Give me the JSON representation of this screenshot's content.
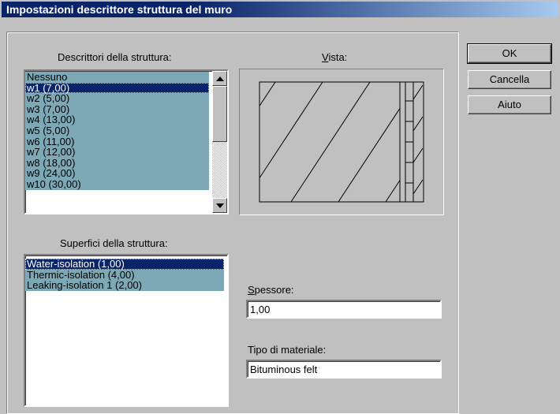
{
  "window": {
    "title": "Impostazioni descrittore struttura del muro"
  },
  "descriptors": {
    "label": "Descrittori della struttura:",
    "items": [
      "Nessuno",
      "w1 (7,00)",
      "w2 (5,00)",
      "w3 (7,00)",
      "w4 (13,00)",
      "w5 (5,00)",
      "w6 (11,00)",
      "w7 (12,00)",
      "w8 (18,00)",
      "w9 (24,00)",
      "w10 (30,00)"
    ],
    "selected": "w1 (7,00)"
  },
  "surfaces": {
    "label": "Superfici della struttura:",
    "items": [
      "Water-isolation (1,00)",
      "Thermic-isolation (4,00)",
      "Leaking-isolation 1 (2,00)"
    ],
    "selected": "Water-isolation (1,00)"
  },
  "preview": {
    "label_key": "V",
    "label_rest": "ista:"
  },
  "thickness": {
    "label_key": "S",
    "label_rest": "pessore:",
    "value": "1,00"
  },
  "material": {
    "label": "Tipo di materiale:",
    "value": "Bituminous felt"
  },
  "buttons": {
    "ok": "OK",
    "cancel": "Cancella",
    "help": "Aiuto"
  },
  "colors": {
    "title_bar": "#0a246a",
    "list_fill": "#7da8b6",
    "selection": "#0a246a",
    "face": "#c0c0c0"
  }
}
